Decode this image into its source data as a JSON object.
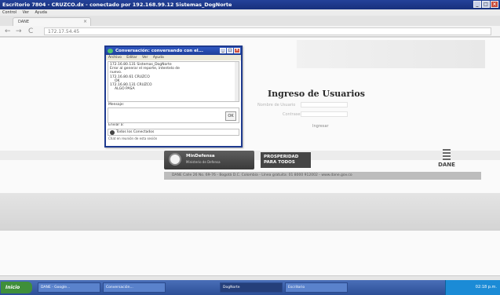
{
  "rdp": {
    "title": "Escritorio 7804 - CRUZCO.dx - conectado por 192.168.99.12 Sistemas_DogNorte",
    "menu": [
      "Control",
      "Ver",
      "Ayuda"
    ]
  },
  "browser": {
    "tab_label": "DANE",
    "url": "172.17.54.45"
  },
  "page": {
    "login_title": "Ingreso de Usuarios",
    "user_label": "Nombre de Usuario",
    "password_label": "Contraseña",
    "submit_label": "Ingresar",
    "mintrabajo_name": "MinDefensa",
    "mintrabajo_sub": "Ministerio de Defensa",
    "prosperidad_line1": "PROSPERIDAD",
    "prosperidad_line2": "PARA TODOS",
    "dane_label": "DANE",
    "footer_text": "DANE Calle 26 No. 69-76 - Bogotá D.C. Colombia - Línea gratuita: 01 8000 912002 - www.dane.gov.co"
  },
  "conversation": {
    "title": "Conversación: conversando con el...",
    "menu": [
      "Archivo",
      "Editar",
      "Ver",
      "Ayuda"
    ],
    "history": [
      "172.16.80.131 Sistemas_DogNorte",
      "Error al generar el reporte, intentelo de",
      "nuevo.",
      "172.16.80.61 CRUZCO",
      "OK",
      "172.16.80.131 CRUZCO",
      "ALGO PASA"
    ],
    "message_label": "Mensaje:",
    "send_label": "OK",
    "contact_label": "Enviar a:",
    "contact_value": "Todos los Conectados",
    "footer": "Chat en reunión de esta sesión"
  },
  "taskbar": {
    "start_label": "Inicio",
    "items": [
      "DANE - Google...",
      "Conversación...",
      "DogNorte",
      "Escritorio"
    ],
    "clock": "02:18 p.m."
  }
}
